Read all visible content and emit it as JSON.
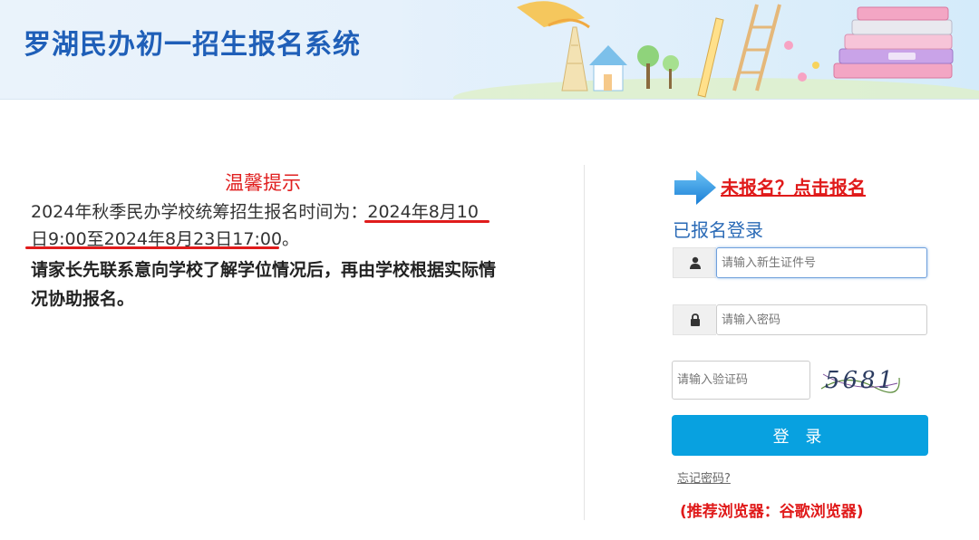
{
  "header": {
    "title": "罗湖民办初一招生报名系统"
  },
  "notice": {
    "title": "温馨提示",
    "line1_prefix": "2024年秋季民办学校统筹招生报名时间为：",
    "line1_date_start": "2024年8月10",
    "line1b_date_end": "日9:00至2024年8月23日17:00",
    "line1b_end": "。",
    "line2": "请家长先联系意向学校了解学位情况后，再由学校根据实际情况协助报名。"
  },
  "login": {
    "register_link": "未报名？点击报名",
    "title": "已报名登录",
    "id_placeholder": "请输入新生证件号",
    "password_placeholder": "请输入密码",
    "captcha_placeholder": "请输入验证码",
    "captcha_text": "5681",
    "login_button": "登 录",
    "forgot_password": "忘记密码?",
    "browser_tip": "(推荐浏览器：谷歌浏览器)"
  },
  "colors": {
    "title_blue": "#1f5fb8",
    "red": "#e01a1a",
    "button_blue": "#08a1e0"
  },
  "icons": {
    "user": "user-icon",
    "lock": "lock-icon",
    "arrow": "arrow-right-icon"
  }
}
